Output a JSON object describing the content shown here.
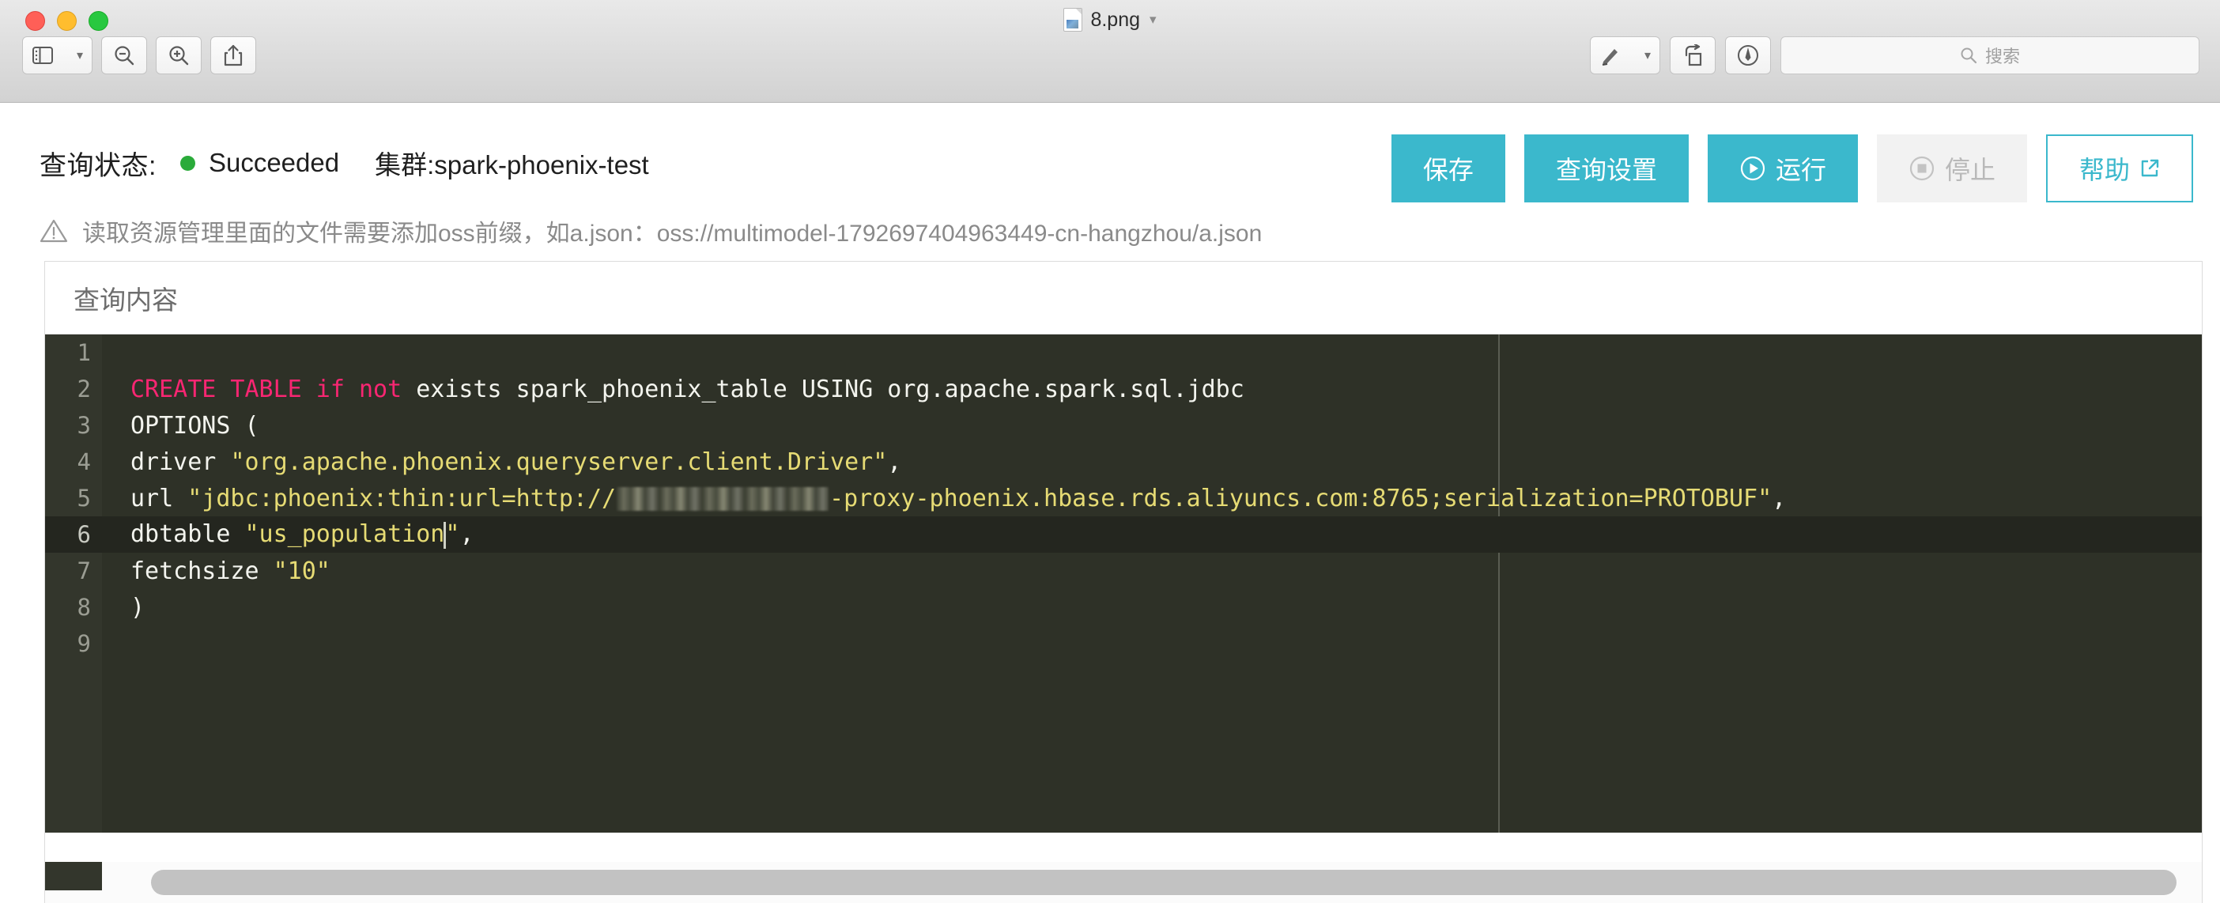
{
  "window": {
    "title": "8.png",
    "title_chevron": "chevron-down",
    "traffic_lights": [
      "close",
      "minimize",
      "zoom"
    ],
    "toolbar_left": [
      {
        "name": "sidebar-view",
        "icon": "sidebar-icon",
        "has_dropdown": true
      },
      {
        "name": "zoom-out",
        "icon": "magnifier-minus-icon"
      },
      {
        "name": "zoom-in",
        "icon": "magnifier-plus-icon"
      },
      {
        "name": "share",
        "icon": "share-icon"
      }
    ],
    "toolbar_right": [
      {
        "name": "markup",
        "icon": "marker-pen-icon",
        "has_dropdown": true
      },
      {
        "name": "rotate",
        "icon": "rotate-icon"
      },
      {
        "name": "annotate",
        "icon": "annotate-icon"
      }
    ],
    "search": {
      "placeholder": "搜索",
      "value": "",
      "icon": "search-icon"
    }
  },
  "status": {
    "label": "查询状态:",
    "value": "Succeeded",
    "dot_color": "#2aab3a",
    "cluster": "集群:spark-phoenix-test"
  },
  "actions": {
    "save": "保存",
    "query_settings": "查询设置",
    "run": "运行",
    "run_icon": "play-circle-icon",
    "stop": "停止",
    "stop_icon": "stop-circle-icon",
    "help": "帮助",
    "help_icon": "external-link-icon",
    "accent_color": "#3bb8cc",
    "disabled_color": "#b9b9b9"
  },
  "warning": {
    "icon": "warning-triangle-icon",
    "text": "读取资源管理里面的文件需要添加oss前缀，如a.json：oss://multimodel-1792697404963449-cn-hangzhou/a.json"
  },
  "editor_panel": {
    "title": "查询内容",
    "active_line": 6,
    "ruler_column": 80,
    "colors": {
      "background": "#2e3127",
      "gutter": "#33362c",
      "active_line": "#24261f",
      "keyword": "#f92672",
      "string": "#e6db74",
      "text": "#f3f4ee",
      "line_number": "#9b9d93"
    },
    "lines": [
      {
        "n": "1",
        "tokens": []
      },
      {
        "n": "2",
        "tokens": [
          {
            "t": "kw",
            "v": "CREATE TABLE if not"
          },
          {
            "t": "plain",
            "v": " exists spark_phoenix_table USING org.apache.spark.sql.jdbc"
          }
        ]
      },
      {
        "n": "3",
        "tokens": [
          {
            "t": "plain",
            "v": "OPTIONS ("
          }
        ]
      },
      {
        "n": "4",
        "tokens": [
          {
            "t": "plain",
            "v": "driver "
          },
          {
            "t": "str",
            "v": "\"org.apache.phoenix.queryserver.client.Driver\""
          },
          {
            "t": "plain",
            "v": ","
          }
        ]
      },
      {
        "n": "5",
        "tokens": [
          {
            "t": "plain",
            "v": "url "
          },
          {
            "t": "str",
            "v": "\"jdbc:phoenix:thin:url=http://"
          },
          {
            "t": "redact",
            "v": ""
          },
          {
            "t": "str",
            "v": "-proxy-phoenix.hbase.rds.aliyuncs.com:8765;serialization=PROTOBUF\""
          },
          {
            "t": "plain",
            "v": ","
          }
        ]
      },
      {
        "n": "6",
        "tokens": [
          {
            "t": "plain",
            "v": "dbtable "
          },
          {
            "t": "str",
            "v": "\"us_population"
          },
          {
            "t": "caret",
            "v": ""
          },
          {
            "t": "str",
            "v": "\""
          },
          {
            "t": "plain",
            "v": ","
          }
        ]
      },
      {
        "n": "7",
        "tokens": [
          {
            "t": "plain",
            "v": "fetchsize "
          },
          {
            "t": "str",
            "v": "\"10\""
          }
        ]
      },
      {
        "n": "8",
        "tokens": [
          {
            "t": "plain",
            "v": ")"
          }
        ]
      },
      {
        "n": "9",
        "tokens": []
      }
    ]
  }
}
